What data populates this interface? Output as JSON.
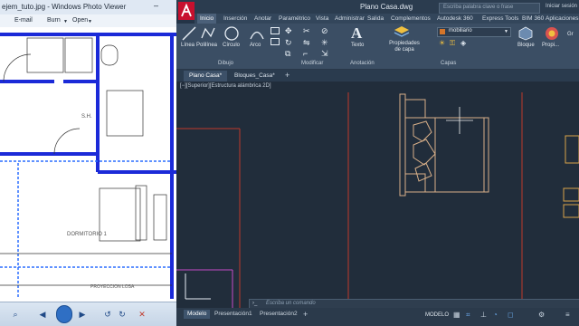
{
  "photo_viewer": {
    "title": "ejem_tuto.jpg - Windows Photo Viewer",
    "menu": {
      "email": "E-mail",
      "burn": "Burn",
      "open": "Open"
    },
    "plan": {
      "room_label": "DORMITORIO 1",
      "bath_label": "S.H.",
      "projection_label": "PROYECCION  LOSA"
    }
  },
  "autocad": {
    "title": "Plano Casa.dwg",
    "search_placeholder": "Escriba palabra clave o frase",
    "login": "Iniciar sesión",
    "ribbon_tabs": [
      "Inicio",
      "Inserción",
      "Anotar",
      "Paramétrico",
      "Vista",
      "Administrar",
      "Salida",
      "Complementos",
      "Autodesk 360",
      "Express Tools",
      "BIM 360",
      "Aplicaciones"
    ],
    "active_tab": "Inicio",
    "tools": {
      "line": "Línea",
      "polyline": "Polilínea",
      "circle": "Círculo",
      "arc": "Arco",
      "text": "Texto",
      "layer_props": "Propiedades de capa",
      "block": "Bloque",
      "props": "Propi...",
      "group": "Gr"
    },
    "layer_name": "mobiliario",
    "panels": {
      "draw": "Dibujo",
      "modify": "Modificar",
      "annotation": "Anotación",
      "layers": "Capas"
    },
    "doc_tabs": [
      "Plano Casa*",
      "Bloques_Casa*"
    ],
    "viewport_label": "[−][Superior][Estructura alámbrica 2D]",
    "command_placeholder": "Escriba un comando",
    "layout_tabs": [
      "Modelo",
      "Presentación1",
      "Presentación2"
    ],
    "status_mode": "MODELO",
    "colors": {
      "accent": "#c8102e",
      "background": "#212d3b",
      "ribbon": "#3b4e64"
    }
  }
}
